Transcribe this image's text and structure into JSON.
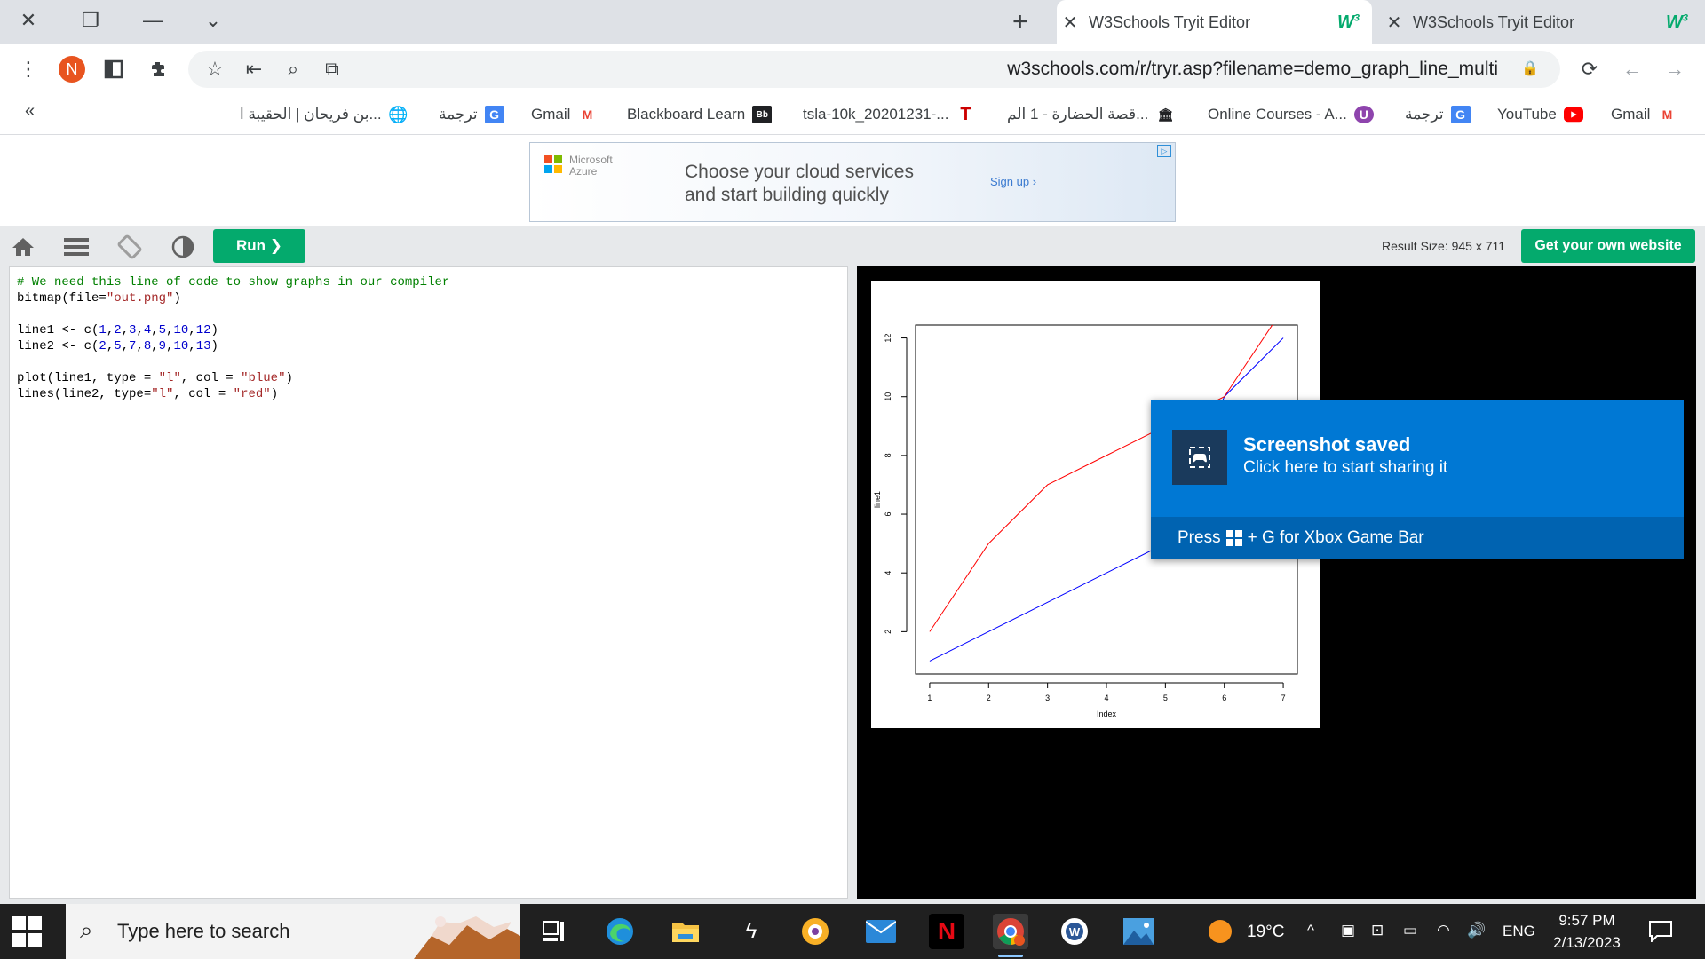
{
  "browser": {
    "window_controls": {
      "close": "✕",
      "restore": "❐",
      "minimize": "—",
      "dropdown": "⌄"
    },
    "tabs": [
      {
        "title": "W3Schools Tryit Editor",
        "logo": "w3",
        "active": true
      },
      {
        "title": "W3Schools Tryit Editor",
        "logo": "w3",
        "active": false
      }
    ],
    "new_tab": "+",
    "profile_initial": "N",
    "url": "w3schools.com/r/tryr.asp?filename=demo_graph_line_multi",
    "bookmarks_chevron": "«",
    "bookmarks": [
      {
        "label": "Gmail",
        "icon": "gmail-icon"
      },
      {
        "label": "YouTube",
        "icon": "youtube-icon"
      },
      {
        "label": "ترجمة",
        "icon": "translate-icon"
      },
      {
        "label": "Online Courses - A...",
        "icon": "courses-icon"
      },
      {
        "label": "قصة الحضارة - 1 الم...",
        "icon": "library-icon"
      },
      {
        "label": "tsla-10k_20201231-...",
        "icon": "tesla-icon"
      },
      {
        "label": "Blackboard Learn",
        "icon": "blackboard-icon"
      },
      {
        "label": "Gmail",
        "icon": "gmail-icon"
      },
      {
        "label": "ترجمة",
        "icon": "translate-icon"
      },
      {
        "label": "بن فريحان | الحقيبة ا...",
        "icon": "globe-icon"
      }
    ]
  },
  "ad": {
    "brand": "Microsoft\nAzure",
    "headline_1": "Choose your cloud services",
    "headline_2": "and start building quickly",
    "cta": "Sign up ›"
  },
  "editor": {
    "run_label": "Run ❯",
    "result_size": "Result Size: 945 x 711",
    "get_website": "Get your own website",
    "code_lines": [
      "# We need this line of code to show graphs in our compiler",
      "bitmap(file=\"out.png\")",
      "",
      "line1 <- c(1,2,3,4,5,10,12)",
      "line2 <- c(2,5,7,8,9,10,13)",
      "",
      "plot(line1, type = \"l\", col = \"blue\")",
      "lines(line2, type=\"l\", col = \"red\")"
    ]
  },
  "chart_data": {
    "type": "line",
    "x": [
      1,
      2,
      3,
      4,
      5,
      6,
      7
    ],
    "series": [
      {
        "name": "line1",
        "values": [
          1,
          2,
          3,
          4,
          5,
          10,
          12
        ],
        "color": "#0000ff"
      },
      {
        "name": "line2",
        "values": [
          2,
          5,
          7,
          8,
          9,
          10,
          13
        ],
        "color": "#ff0000"
      }
    ],
    "xlabel": "Index",
    "ylabel": "line1",
    "xticks": [
      "1",
      "2",
      "3",
      "4",
      "5",
      "6",
      "7"
    ],
    "yticks": [
      "2",
      "4",
      "6",
      "8",
      "10",
      "12"
    ],
    "xlim": [
      0.76,
      7.24
    ],
    "ylim": [
      0.56,
      12.44
    ],
    "grid": false
  },
  "toast": {
    "title": "Screenshot saved",
    "subtitle": "Click here to start sharing it",
    "hint_prefix": "Press",
    "hint_suffix": "+ G for Xbox Game Bar"
  },
  "taskbar": {
    "search_placeholder": "Type here to search",
    "weather": "19°C",
    "language": "ENG",
    "time": "9:57 PM",
    "date": "2/13/2023"
  },
  "colors": {
    "w3_green": "#04aa6d",
    "toast_blue": "#0078d4",
    "taskbar": "#202020"
  }
}
